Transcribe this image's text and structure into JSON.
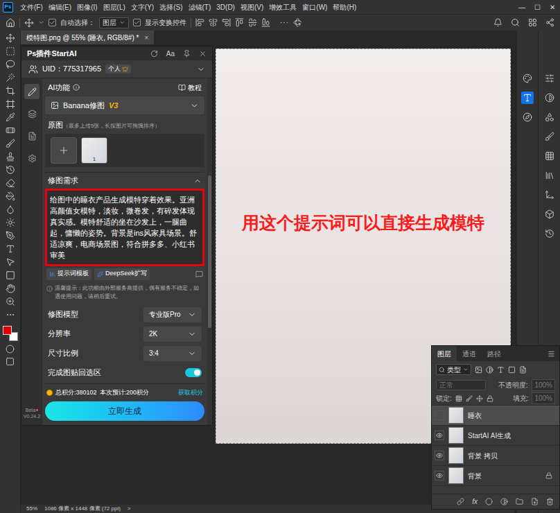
{
  "app": {
    "logo": "Ps"
  },
  "menu": [
    "文件(F)",
    "编辑(E)",
    "图像(I)",
    "图层(L)",
    "文字(Y)",
    "选择(S)",
    "滤镜(T)",
    "3D(D)",
    "视图(V)",
    "增效工具",
    "窗口(W)",
    "帮助(H)"
  ],
  "window_controls": [
    "—",
    "☐",
    "✕"
  ],
  "options_bar": {
    "auto_select": {
      "label": "自动选择：",
      "checked": true
    },
    "target": "图层",
    "show_transform": {
      "label": "显示变换控件",
      "checked": true
    },
    "more": "···"
  },
  "document_tab": {
    "title": "模特图.png @ 55% (睡衣, RGB/8#) *",
    "close": "×"
  },
  "colors": {
    "foreground": "#e30000",
    "background": "#ffffff"
  },
  "plugin": {
    "title": "Ps插件StartAI",
    "font_button": "Aa",
    "uid": "UID：775317965",
    "account": "个人",
    "side_items": [
      {
        "kind": "edit",
        "selected": true
      },
      {
        "kind": "layers",
        "selected": false
      },
      {
        "kind": "files",
        "selected": false
      },
      {
        "kind": "settings",
        "selected": false
      }
    ],
    "section_label": "AI功能",
    "tutorial": "教程",
    "function": {
      "name": "Banana修图",
      "version": "V3"
    },
    "source": {
      "label": "原图",
      "hint": "（最多上传5张，长按图片可拖拽排序）",
      "images": [
        {
          "index": "1"
        }
      ]
    },
    "prompt": {
      "label": "修图需求",
      "expanded": true,
      "text": "给图中的睡衣产品生成模特穿着效果。亚洲高颜值女模特，淡妆，微卷发，有碎发体现真实感。模特舒适的坐在沙发上，一腿曲起，慵懒的姿势。背景是ins风家具场景。舒适凉爽，电商场景图，符合拼多多、小红书审美",
      "buttons": [
        "提示词模板",
        "DeepSeek扩写"
      ]
    },
    "notice": "温馨提示：此功能由外部服务商提供，偶有服务不稳定，如遇使用问题，请稍后重试。",
    "settings": [
      {
        "label": "修图模型",
        "kind": "select",
        "value": "专业版Pro"
      },
      {
        "label": "分辨率",
        "kind": "select",
        "value": "2K"
      },
      {
        "label": "尺寸比例",
        "kind": "select",
        "value": "3:4"
      },
      {
        "label": "完成图贴回选区",
        "kind": "toggle",
        "on": true
      }
    ],
    "points": {
      "total": "总积分:380102",
      "estimate": "本次预计:200积分",
      "link": "获取积分"
    },
    "generate": "立即生成",
    "version": {
      "label": "Beta",
      "number": "V0.24.2"
    }
  },
  "annotation": {
    "text": "用这个提示词可以直接生成模特"
  },
  "layers_panel": {
    "tabs": [
      {
        "label": "图层",
        "selected": true
      },
      {
        "label": "通道",
        "selected": false
      },
      {
        "label": "路径",
        "selected": false
      }
    ],
    "filter": "类型",
    "blend": {
      "value": "正常",
      "disabled": true
    },
    "opacity": {
      "label": "不透明度:",
      "value": "100%",
      "disabled": true
    },
    "lock": "锁定:",
    "fill": {
      "label": "填充:",
      "value": "100%",
      "disabled": true
    },
    "layers": [
      {
        "name": "睡衣",
        "visible": false,
        "selected": true,
        "locked": false
      },
      {
        "name": "StartAI AI生成",
        "visible": true,
        "selected": false,
        "locked": false
      },
      {
        "name": "背景 拷贝",
        "visible": true,
        "selected": false,
        "locked": false
      },
      {
        "name": "背景",
        "visible": true,
        "selected": false,
        "locked": true
      }
    ],
    "fx": "fx"
  },
  "status_bar": {
    "zoom": "55%",
    "info": "1086 像素 x 1448 像素 (72 ppi)",
    "arrow": ">"
  }
}
